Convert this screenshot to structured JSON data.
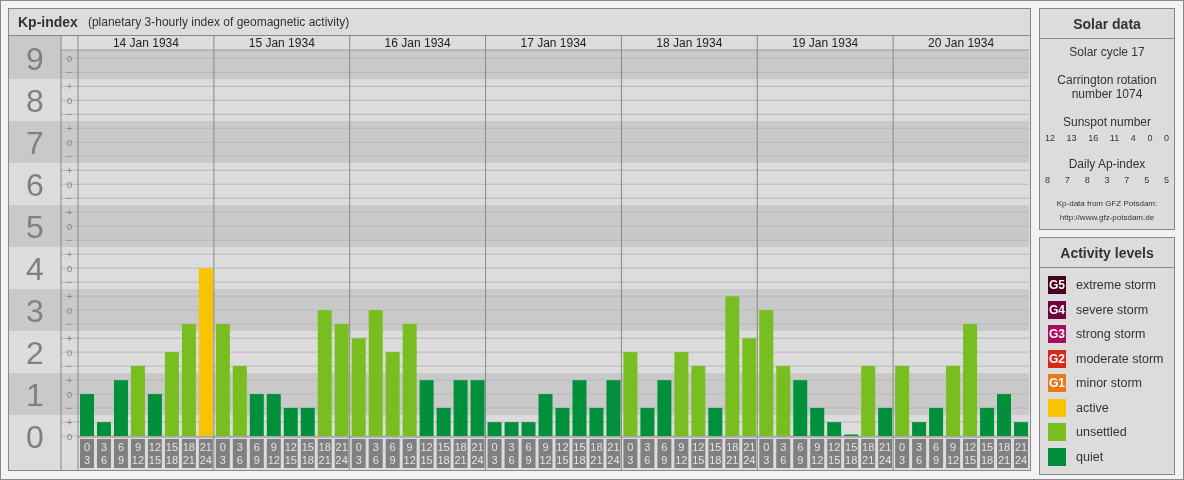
{
  "kp_panel": {
    "title": "Kp-index",
    "subtitle": "(planetary 3-hourly index of geomagnetic activity)",
    "chart_data": {
      "type": "bar",
      "grid": true,
      "ylim": [
        0,
        9.2
      ],
      "yticks": [
        {
          "value": 0,
          "label": "0"
        },
        {
          "value": 1,
          "label": "1"
        },
        {
          "value": 2,
          "label": "2"
        },
        {
          "value": 3,
          "label": "3"
        },
        {
          "value": 4,
          "label": "4"
        },
        {
          "value": 5,
          "label": "5"
        },
        {
          "value": 6,
          "label": "6"
        },
        {
          "value": 7,
          "label": "7"
        },
        {
          "value": 8,
          "label": "8"
        },
        {
          "value": 9,
          "label": "9"
        }
      ],
      "categories": [
        "0\n3",
        "3\n6",
        "6\n9",
        "9\n12",
        "12\n15",
        "15\n18",
        "18\n21",
        "21\n24",
        "0\n3",
        "3\n6",
        "6\n9",
        "9\n12",
        "12\n15",
        "15\n18",
        "18\n21",
        "21\n24",
        "0\n3",
        "3\n6",
        "6\n9",
        "9\n12",
        "12\n15",
        "15\n18",
        "18\n21",
        "21\n24",
        "0\n3",
        "3\n6",
        "6\n9",
        "9\n12",
        "12\n15",
        "15\n18",
        "18\n21",
        "21\n24",
        "0\n3",
        "3\n6",
        "6\n9",
        "9\n12",
        "12\n15",
        "15\n18",
        "18\n21",
        "21\n24",
        "0\n3",
        "3\n6",
        "6\n9",
        "9\n12",
        "12\n15",
        "15\n18",
        "18\n21",
        "21\n24",
        "0\n3",
        "3\n6",
        "6\n9",
        "9\n12",
        "12\n15",
        "15\n18",
        "18\n21",
        "21\n24"
      ],
      "series": [
        {
          "color": "#00903c",
          "values": [
            1,
            0.33,
            1.33,
            null,
            1,
            null,
            null,
            null,
            null,
            null,
            1,
            1,
            0.67,
            0.67,
            null,
            null,
            null,
            null,
            null,
            null,
            1.33,
            0.67,
            1.33,
            1.33,
            0.33,
            0.33,
            0.33,
            1,
            0.67,
            1.33,
            0.67,
            1.33,
            null,
            0.67,
            1.33,
            null,
            null,
            0.67,
            null,
            null,
            null,
            null,
            1.33,
            0.67,
            0.33,
            0,
            null,
            0.67,
            null,
            0.33,
            0.67,
            null,
            null,
            0.67,
            1,
            0.33
          ]
        },
        {
          "color": "#78be20",
          "values": [
            null,
            null,
            null,
            1.67,
            null,
            2,
            2.67,
            null,
            2.67,
            1.67,
            null,
            null,
            null,
            null,
            3,
            2.67,
            2.33,
            3,
            2,
            2.67,
            null,
            null,
            null,
            null,
            null,
            null,
            null,
            null,
            null,
            null,
            null,
            null,
            2,
            null,
            null,
            2,
            1.67,
            null,
            3.33,
            2.33,
            3,
            1.67,
            null,
            null,
            null,
            null,
            1.67,
            null,
            1.67,
            null,
            null,
            1.67,
            2.67,
            null,
            null,
            null
          ]
        },
        {
          "color": "#f8c400",
          "values": [
            null,
            null,
            null,
            null,
            null,
            null,
            null,
            4,
            null,
            null,
            null,
            null,
            null,
            null,
            null,
            null,
            null,
            null,
            null,
            null,
            null,
            null,
            null,
            null,
            null,
            null,
            null,
            null,
            null,
            null,
            null,
            null,
            null,
            null,
            null,
            null,
            null,
            null,
            null,
            null,
            null,
            null,
            null,
            null,
            null,
            null,
            null,
            null,
            null,
            null,
            null,
            null,
            null,
            null,
            null,
            null
          ]
        }
      ]
    },
    "y_marks": [
      "o",
      "−",
      "+",
      "o",
      "−",
      "+",
      "o",
      "−",
      "+",
      "o",
      "−",
      "+",
      "o",
      "−",
      "+",
      "o",
      "−",
      "+",
      "o",
      "−",
      "+",
      "o",
      "−",
      "+",
      "o",
      "−",
      "+",
      "o"
    ],
    "day_labels": [
      "14 Jan 1934",
      "15 Jan 1934",
      "16 Jan 1934",
      "17 Jan 1934",
      "18 Jan 1934",
      "19 Jan 1934",
      "20 Jan 1934"
    ]
  },
  "solar_data": {
    "title": "Solar data",
    "cycle": "Solar cycle 17",
    "carrington": "Carrington rotation number 1074",
    "sunspot_label": "Sunspot number",
    "sunspot_values": [
      "12",
      "13",
      "16",
      "11",
      "4",
      "0",
      "0"
    ],
    "ap_label": "Daily Ap-index",
    "ap_values": [
      "8",
      "7",
      "8",
      "3",
      "7",
      "5",
      "5"
    ],
    "credit": "Kp-data from GFZ Potsdam:",
    "credit_url": "http://www.gfz-potsdam.de"
  },
  "activity_levels": {
    "title": "Activity levels",
    "items": [
      {
        "badge": "G5",
        "label": "extreme storm",
        "color": "#48001e"
      },
      {
        "badge": "G4",
        "label": "severe storm",
        "color": "#6e0040"
      },
      {
        "badge": "G3",
        "label": "strong storm",
        "color": "#a80c5c"
      },
      {
        "badge": "G2",
        "label": "moderate storm",
        "color": "#d8281a"
      },
      {
        "badge": "G1",
        "label": "minor storm",
        "color": "#e8781a"
      },
      {
        "label": "active",
        "color": "#f8c400"
      },
      {
        "label": "unsettled",
        "color": "#78be20"
      },
      {
        "label": "quiet",
        "color": "#00903c"
      }
    ]
  }
}
